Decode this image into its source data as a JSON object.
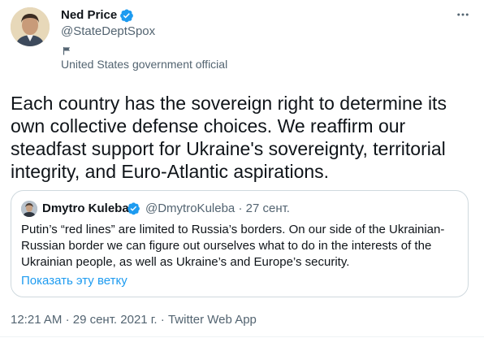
{
  "author": {
    "name": "Ned Price",
    "handle": "@StateDeptSpox",
    "verified": true,
    "label": "United States government official",
    "label_icon": "flag-icon"
  },
  "tweet": {
    "text": "Each country has the sovereign right to determine its\nown collective defense choices. We reaffirm our\nsteadfast support for Ukraine's sovereignty, territorial\nintegrity, and Euro-Atlantic aspirations."
  },
  "quoted": {
    "name": "Dmytro Kuleba",
    "handle": "@DmytroKuleba",
    "separator": "·",
    "date": "27 сент.",
    "text": "Putin’s “red lines” are limited to Russia’s borders. On our side of the Ukrainian-\nRussian border we can figure out ourselves what to do in the interests of the\nUkrainian people, as well as Ukraine’s and Europe’s security.",
    "show_thread": "Показать эту ветку"
  },
  "footer": {
    "time": "12:21 AM",
    "separator1": "·",
    "date": "29 сент. 2021 г.",
    "separator2": "·",
    "client": "Twitter Web App"
  },
  "colors": {
    "verified_badge": "#1d9bf0",
    "link": "#1d9bf0",
    "secondary_text": "#536471",
    "primary_text": "#0f1419",
    "border": "#cfd9de"
  }
}
